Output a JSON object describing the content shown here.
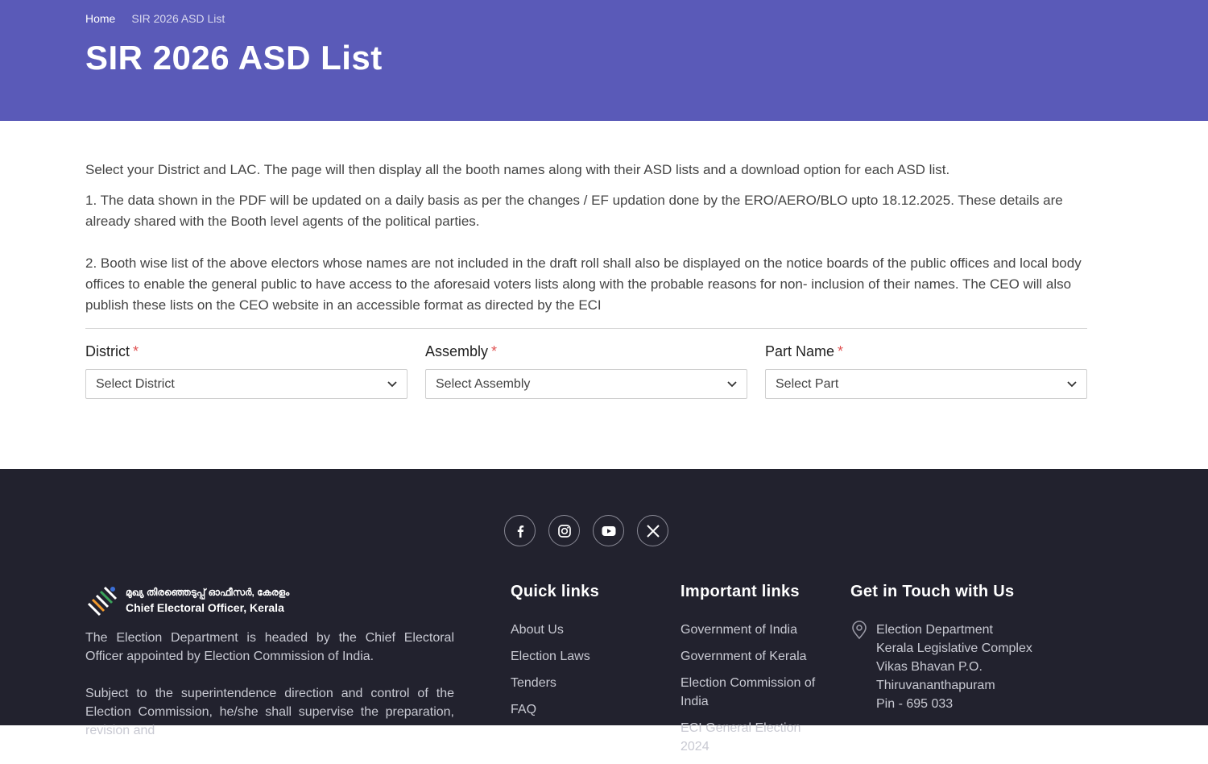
{
  "breadcrumb": {
    "home": "Home",
    "current": "SIR 2026 ASD List"
  },
  "page_title": "SIR 2026 ASD List",
  "intro": "Select your District and LAC. The page will then display all the booth names along with their ASD lists and a download option for each ASD list.",
  "note1": "1. The data shown in the PDF will be updated on a daily basis as per the changes / EF updation done by the ERO/AERO/BLO upto 18.12.2025. These details are already shared with the Booth level agents of the political parties.",
  "note2": "2. Booth wise list of the above electors whose names are not included in the draft roll shall also be displayed on the notice boards of the public offices and local body offices to enable the general public to have access to the aforesaid voters lists along with the probable reasons for non- inclusion of their names. The CEO will also publish these lists on the CEO website in an accessible format as directed by the ECI",
  "form": {
    "district": {
      "label": "District",
      "required": "*",
      "value": "Select District"
    },
    "assembly": {
      "label": "Assembly",
      "required": "*",
      "value": "Select Assembly"
    },
    "part": {
      "label": "Part Name",
      "required": "*",
      "value": "Select Part"
    }
  },
  "socials": [
    "facebook-icon",
    "instagram-icon",
    "youtube-icon",
    "x-icon"
  ],
  "footer": {
    "logo_ml": "മുഖ്യ തിരഞ്ഞെടുപ്പ് ഓഫീസർ, കേരളം",
    "logo_en": "Chief Electoral Officer, Kerala",
    "about_1": "The Election Department is headed by the Chief Electoral Officer appointed by Election Commission of India.",
    "about_2": "Subject to the superintendence direction and control of the Election Commission, he/she shall supervise the preparation, revision and",
    "quick_title": "Quick links",
    "quick_links": [
      "About Us",
      "Election Laws",
      "Tenders",
      "FAQ"
    ],
    "important_title": "Important links",
    "important_links": [
      "Government of India",
      "Government of Kerala",
      "Election Commission of India",
      "ECI General Election 2024"
    ],
    "contact_title": "Get in Touch with Us",
    "contact_lines": [
      "Election Department",
      "Kerala Legislative Complex",
      "Vikas Bhavan P.O.",
      "Thiruvananthapuram",
      "Pin - 695 033"
    ]
  },
  "colors": {
    "header_bg": "#5a5ab8",
    "footer_bg": "#22222e",
    "required": "#e05252"
  }
}
